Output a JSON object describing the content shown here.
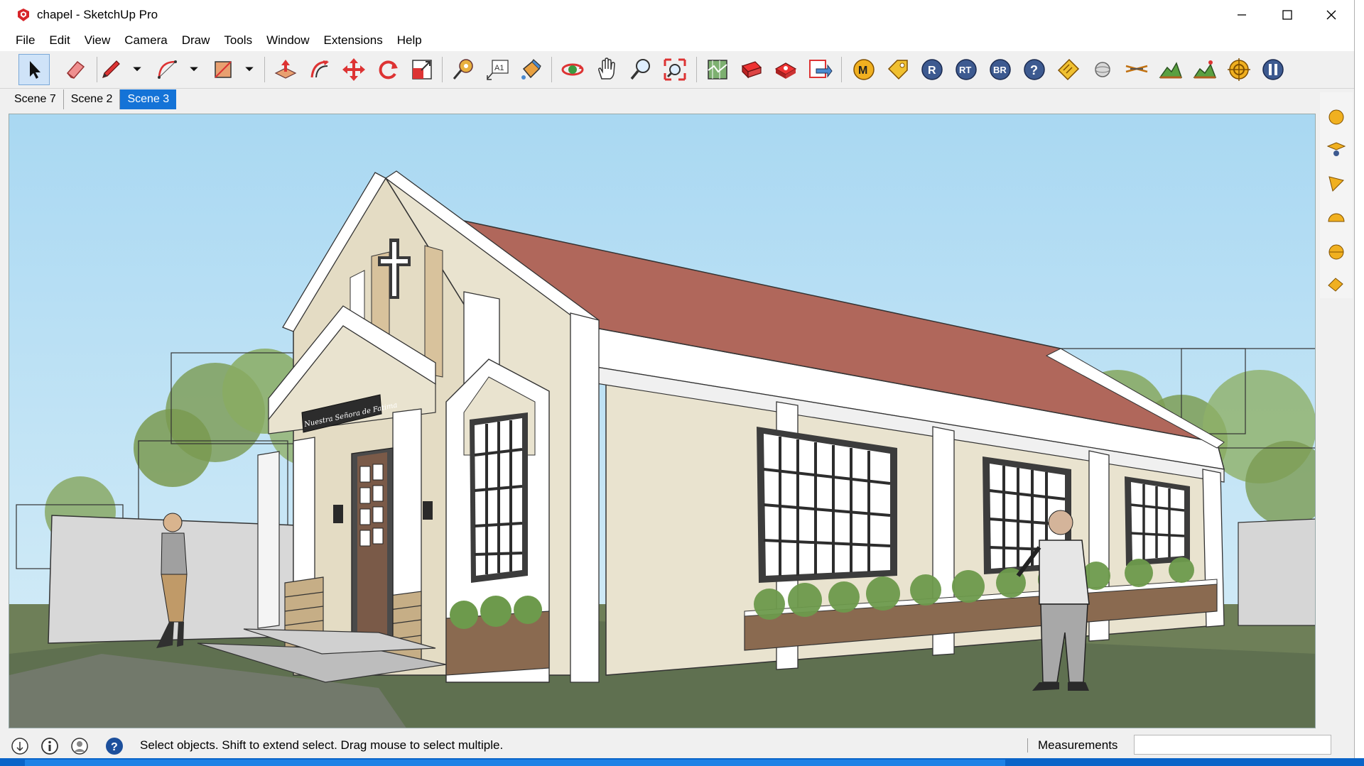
{
  "window": {
    "title": "chapel - SketchUp Pro",
    "controls": [
      "minimize",
      "maximize",
      "close"
    ]
  },
  "menu": {
    "items": [
      "File",
      "Edit",
      "View",
      "Camera",
      "Draw",
      "Tools",
      "Window",
      "Extensions",
      "Help"
    ]
  },
  "toolbar": {
    "tools": [
      "select-icon",
      "eraser-icon",
      "pencil-icon",
      "arc-icon",
      "rectangle-icon",
      "push-pull-icon",
      "offset-icon",
      "move-icon",
      "rotate-icon",
      "scale-icon",
      "tape-measure-icon",
      "text-icon",
      "paint-bucket-icon",
      "orbit-icon",
      "pan-icon",
      "zoom-icon",
      "zoom-extents-icon",
      "model-info-icon",
      "components-icon",
      "materials-icon",
      "export-icon",
      "m-plugin-icon",
      "tag-plugin-icon",
      "r-plugin-icon",
      "rt-plugin-icon",
      "br-plugin-icon",
      "help-icon",
      "label-icon",
      "sphere-icon",
      "section-icon",
      "terrain-icon",
      "terrain-2-icon",
      "target-icon",
      "pause-icon"
    ]
  },
  "scenes": {
    "tabs": [
      "Scene 7",
      "Scene 2",
      "Scene 3"
    ],
    "active": "Scene 3"
  },
  "viewport": {
    "sign_text": "Nuestra Señora de Fatima"
  },
  "colors": {
    "sky": "#bfe2f4",
    "roof": "#b0675b",
    "wall_cream": "#e9e3cf",
    "trim_white": "#ffffff",
    "ground": "#6e7f58",
    "accent_blue": "#1473d7"
  },
  "status": {
    "message": "Select objects. Shift to extend select. Drag mouse to select multiple.",
    "measurements_label": "Measurements",
    "measurements_value": ""
  }
}
